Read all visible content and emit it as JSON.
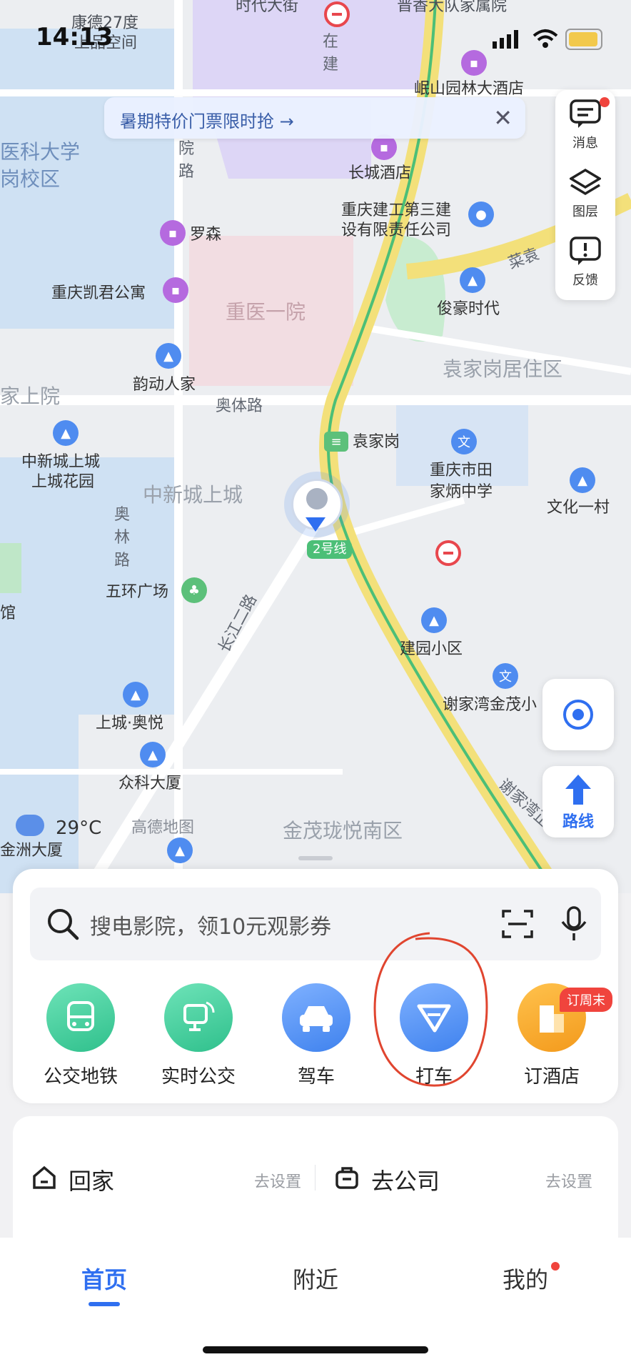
{
  "status_bar": {
    "time": "14:13"
  },
  "banner": {
    "text": "暑期特价门票限时抢 →",
    "close": "✕"
  },
  "side_panel": {
    "messages": "消息",
    "layers": "图层",
    "feedback": "反馈"
  },
  "map": {
    "labels": [
      "康德27度",
      "上品空间",
      "时代大街",
      "晋香大队家属院",
      "岷山园林大酒店",
      "医科大学",
      "岗校区",
      "院",
      "路",
      "长城酒店",
      "重庆建工第三建",
      "设有限责任公司",
      "罗森",
      "重庆凯君公寓",
      "重医一院",
      "俊豪时代",
      "菜袁",
      "袁家岗居住区",
      "韵动人家",
      "奥体路",
      "家上院",
      "袁家岗",
      "中新城上城",
      "上城花园",
      "中新城上城",
      "重庆市田",
      "家炳中学",
      "文化一村",
      "奥",
      "林",
      "路",
      "五环广场",
      "馆",
      "长江二路",
      "建园小区",
      "谢家湾金茂小",
      "上城·奥悦",
      "众科大厦",
      "29°C",
      "高德地图",
      "金洲大厦",
      "金茂珑悦南区",
      "谢家湾正",
      "2号线",
      "在",
      "建"
    ],
    "weather": "29°C",
    "metro_line": "2号线"
  },
  "map_controls": {
    "route_label": "路线"
  },
  "search": {
    "placeholder": "搜电影院，领10元观影券"
  },
  "shortcuts": [
    {
      "label": "公交地铁",
      "color": "#3fcf9f"
    },
    {
      "label": "实时公交",
      "color": "#3fcf9f"
    },
    {
      "label": "驾车",
      "color": "#4b8ff3"
    },
    {
      "label": "打车",
      "color": "#4b8ff3"
    },
    {
      "label": "订酒店",
      "color": "#f4a72a"
    }
  ],
  "hotel_badge": "订周末",
  "places": {
    "home": {
      "label": "回家",
      "action": "去设置"
    },
    "company": {
      "label": "去公司",
      "action": "去设置"
    }
  },
  "tabs": {
    "home": "首页",
    "nearby": "附近",
    "mine": "我的"
  }
}
